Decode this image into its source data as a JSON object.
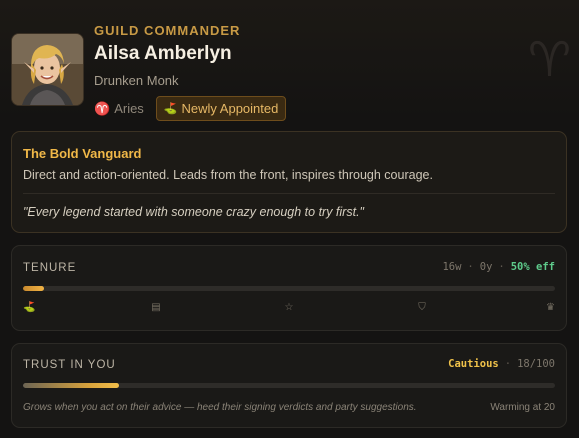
{
  "header": {
    "role": "GUILD COMMANDER",
    "name": "Ailsa Amberlyn",
    "subtitle": "Drunken Monk",
    "zodiac_label": "Aries",
    "zodiac_glyph": "♈",
    "badge_label": "Newly Appointed",
    "badge_icon": "flag-icon"
  },
  "archetype": {
    "title": "The Bold Vanguard",
    "description": "Direct and action-oriented. Leads from the front, inspires through courage.",
    "quote": "\"Every legend started with someone crazy enough to try first.\""
  },
  "tenure": {
    "label": "TENURE",
    "weeks": "16w",
    "years": "0y",
    "efficiency": "50% eff",
    "progress": 0.04,
    "milestones": [
      {
        "icon": "flag-icon",
        "glyph": "⛳",
        "position": 0.0,
        "active": true
      },
      {
        "icon": "clipboard-icon",
        "glyph": "▤",
        "position": 0.25,
        "active": false
      },
      {
        "icon": "star-icon",
        "glyph": "☆",
        "position": 0.5,
        "active": false
      },
      {
        "icon": "shield-icon",
        "glyph": "⛉",
        "position": 0.75,
        "active": false
      },
      {
        "icon": "crown-icon",
        "glyph": "♛",
        "position": 1.0,
        "active": false
      }
    ]
  },
  "trust": {
    "label": "TRUST IN YOU",
    "level": "Cautious",
    "score": "18/100",
    "progress": 0.18,
    "note": "Grows when you act on their advice — heed their signing verdicts and party suggestions.",
    "next_threshold": "Warming at 20"
  },
  "colors": {
    "accent": "#f0b848",
    "efficiency": "#5ecb8b",
    "cautious": "#f0c24a",
    "background": "#141312"
  }
}
